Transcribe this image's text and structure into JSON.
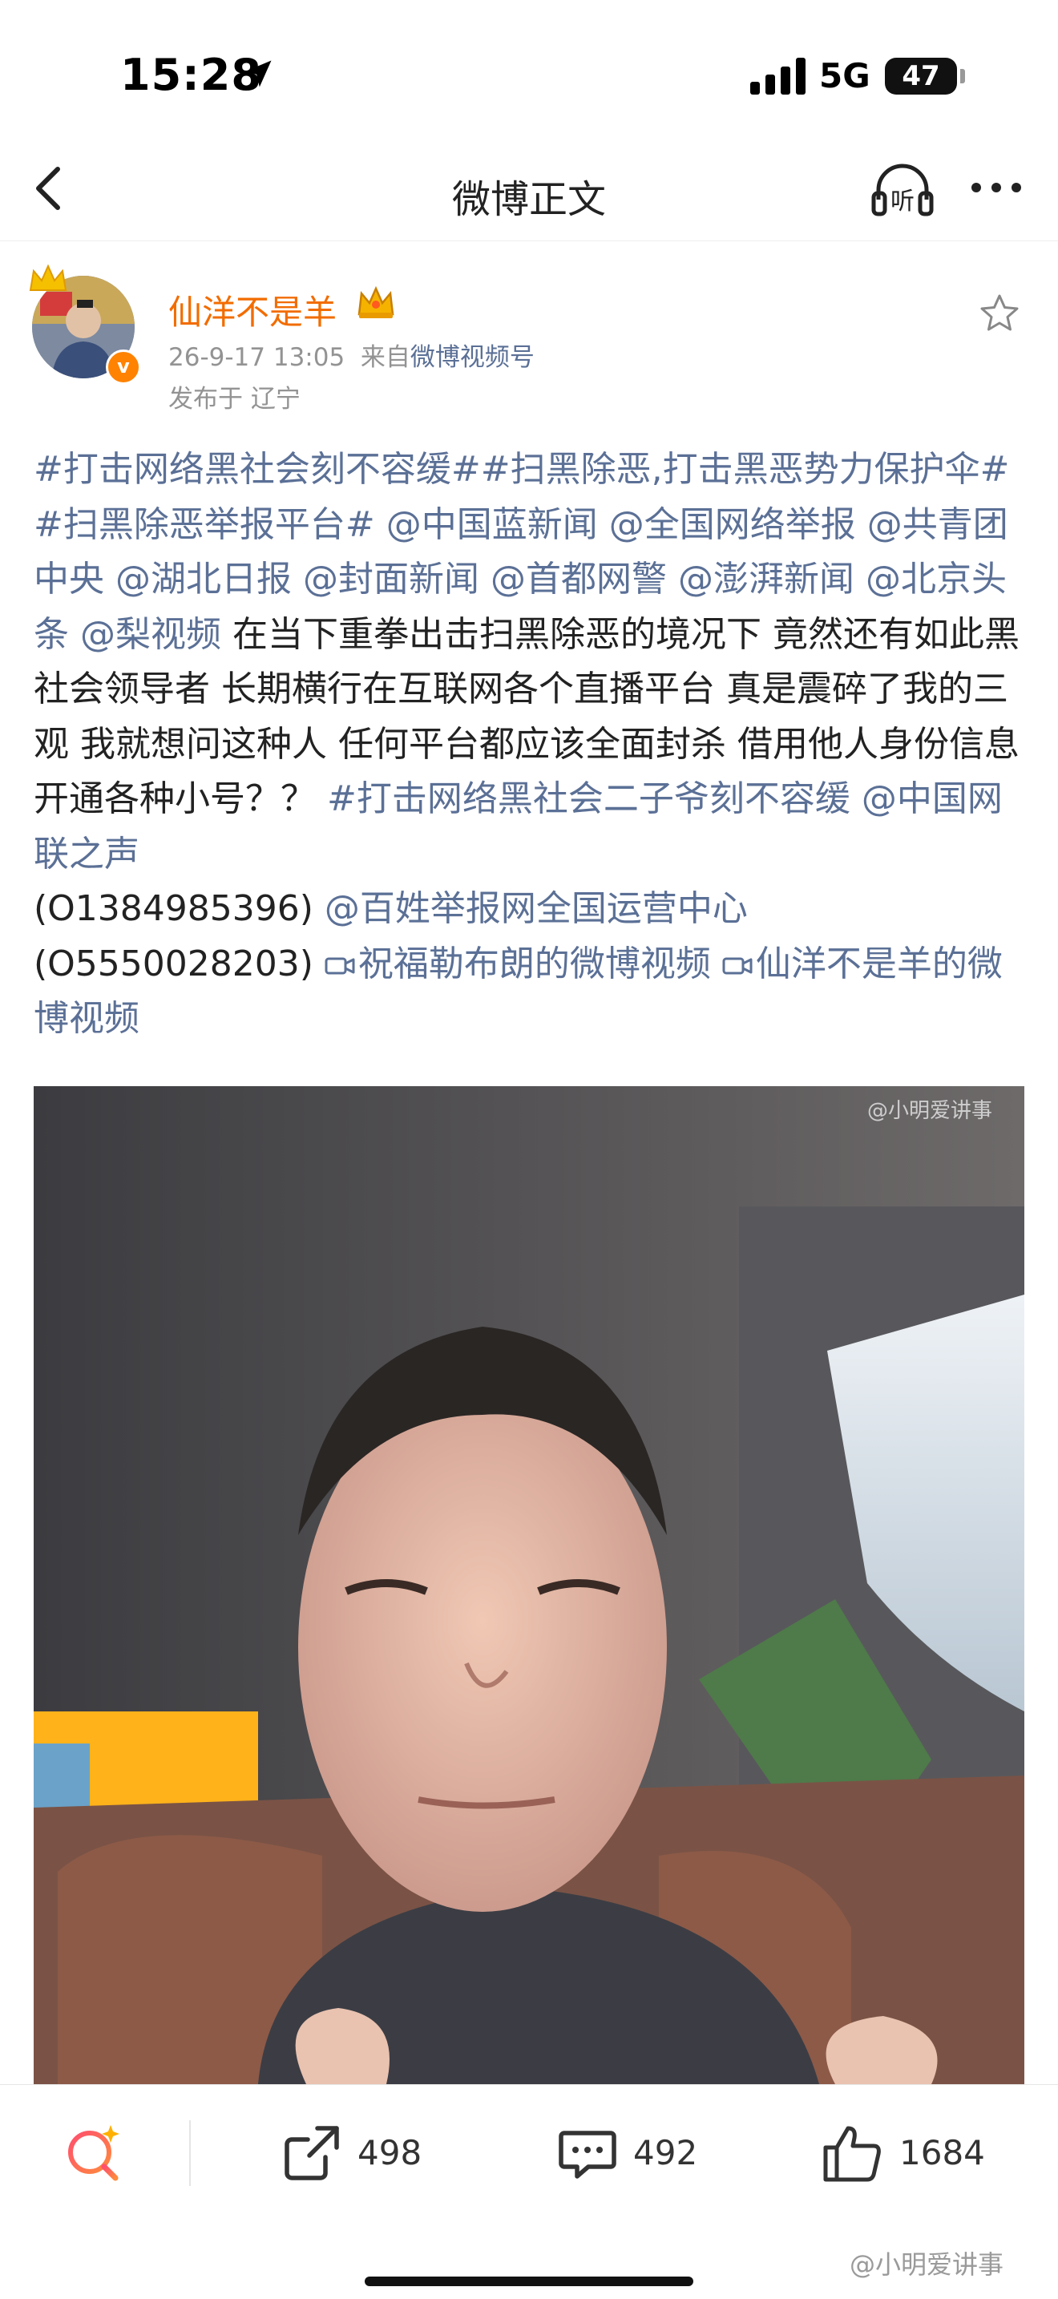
{
  "status_bar": {
    "time": "15:28",
    "network": "5G",
    "battery": "47"
  },
  "nav": {
    "title": "微博正文",
    "listen_label": "听"
  },
  "author": {
    "name": "仙洋不是羊",
    "time": "26-9-17 13:05",
    "source_prefix": "来自",
    "source": "微博视频号",
    "location": "发布于 辽宁"
  },
  "post": {
    "tag1": "#打击网络黑社会刻不容缓#",
    "tag2": "#扫黑除恶,打击黑恶势力保护伞#",
    "tag3": "#扫黑除恶举报平台#",
    "mentions1": [
      " @中国蓝新闻",
      " @全国网络举报",
      " @共青团中央",
      " @湖北日报",
      " @封面新闻",
      " @首都网警",
      " @澎湃新闻",
      " @北京头条",
      " @梨视频"
    ],
    "body": "  在当下重拳出击扫黑除恶的境况下    竟然还有如此黑社会领导者  长期横行在互联网各个直播平台    真是震碎了我的三观    我就想问这种人 任何平台都应该全面封杀 借用他人身份信息开通各种小号？？  ",
    "tag4": "#打击网络黑社会二子爷刻不容缓",
    "mention_a": " @中国网联之声",
    "phone_a": " (O1384985396)",
    "mention_b": " @百姓举报网全国运营中心",
    "phone_b": " (O5550028203)",
    "video_link1": "祝福勒布朗的微博视频",
    "video_link2": "仙洋不是羊的微博视频"
  },
  "video": {
    "watermark": "@小明爱讲事"
  },
  "actions": {
    "reposts": "498",
    "comments": "492",
    "likes": "1684"
  },
  "watermark": "@小明爱讲事",
  "colors": {
    "link": "#5b7096",
    "username": "#f26c00",
    "badge": "#ff8200"
  }
}
